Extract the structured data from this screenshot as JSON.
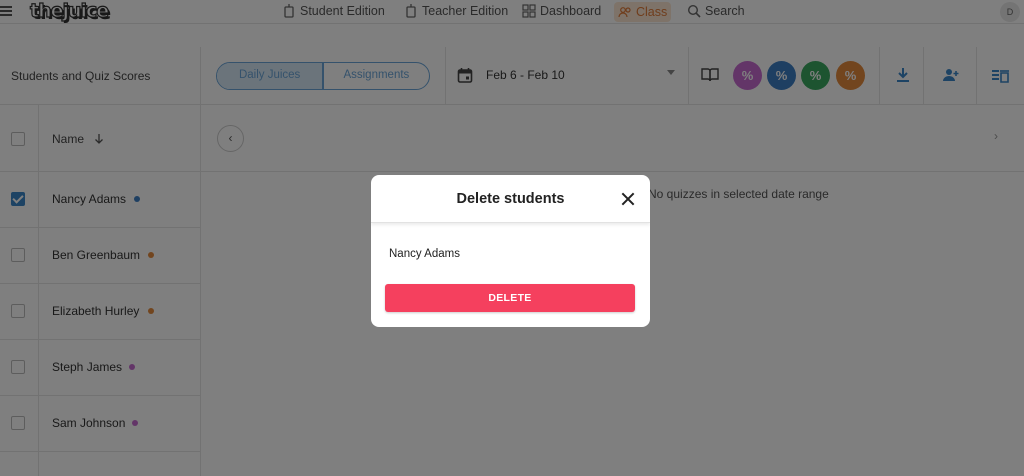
{
  "app": {
    "logo": "thejuice"
  },
  "nav": {
    "items": [
      {
        "label": "Student Edition",
        "icon": "juice-box-icon"
      },
      {
        "label": "Teacher Edition",
        "icon": "juice-box-icon"
      },
      {
        "label": "Dashboard",
        "icon": "grid-icon"
      },
      {
        "label": "Class",
        "icon": "people-icon",
        "active": true
      },
      {
        "label": "Search",
        "icon": "search-icon"
      }
    ],
    "avatar": "D"
  },
  "toolbar": {
    "title": "Students and Quiz Scores",
    "segments": [
      "Daily Juices",
      "Assignments"
    ],
    "active_segment": "Daily Juices",
    "date_range": "Feb 6 - Feb 10",
    "score_buttons": [
      {
        "label": "%",
        "color": "#c66bd1"
      },
      {
        "label": "%",
        "color": "#3d7fc4"
      },
      {
        "label": "%",
        "color": "#3aa860"
      },
      {
        "label": "%",
        "color": "#e48a3d"
      }
    ]
  },
  "table": {
    "name_header": "Name",
    "sort_icon": "arrow-down-icon",
    "empty_message": "No quizzes in selected date range",
    "students": [
      {
        "name": "Nancy Adams",
        "checked": true,
        "dot_color": "#3d7fc4"
      },
      {
        "name": "Ben Greenbaum",
        "checked": false,
        "dot_color": "#e48a3d"
      },
      {
        "name": "Elizabeth Hurley",
        "checked": false,
        "dot_color": "#e48a3d"
      },
      {
        "name": "Steph James",
        "checked": false,
        "dot_color": "#c66bd1"
      },
      {
        "name": "Sam Johnson",
        "checked": false,
        "dot_color": "#c66bd1"
      }
    ]
  },
  "modal": {
    "title": "Delete students",
    "student_name": "Nancy Adams",
    "delete_label": "DELETE"
  }
}
